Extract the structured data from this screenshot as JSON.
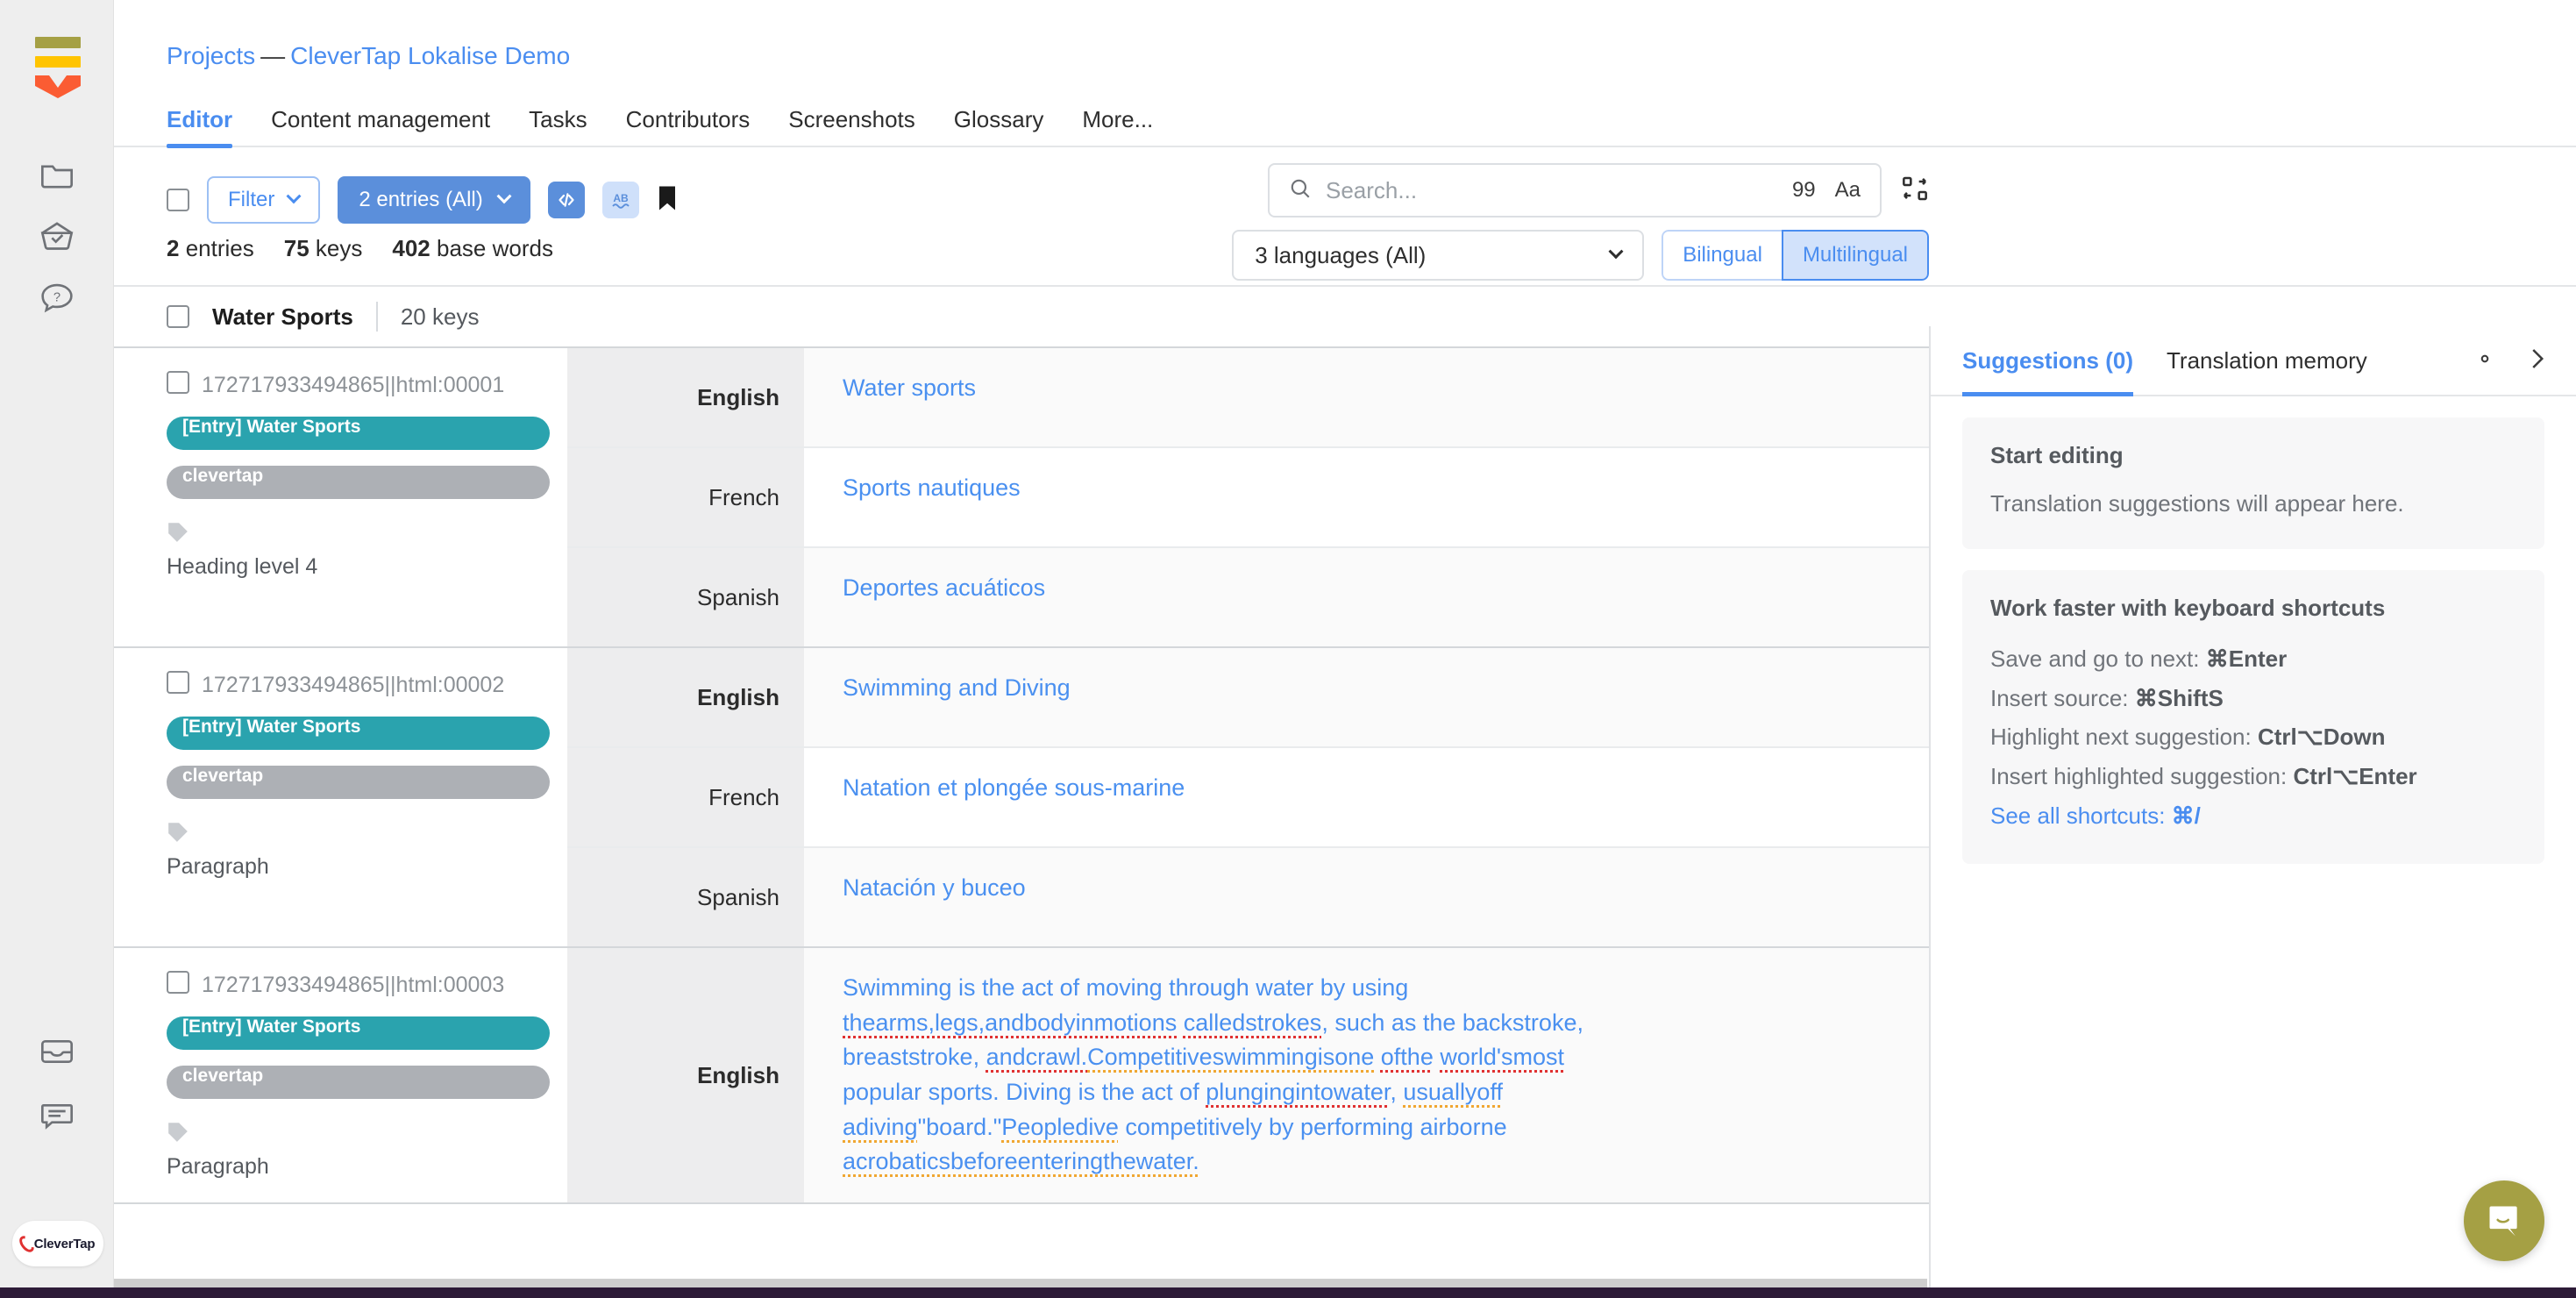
{
  "rail": {
    "logo_name": "lokalise-logo",
    "items": [
      {
        "name": "projects-icon",
        "label": "Projects"
      },
      {
        "name": "tasks-basket-icon",
        "label": "Tasks"
      },
      {
        "name": "help-icon",
        "label": "Help"
      },
      {
        "name": "inbox-icon",
        "label": "Inbox"
      },
      {
        "name": "messages-icon",
        "label": "Messages"
      }
    ],
    "account_badge": "CleverTap"
  },
  "breadcrumb": {
    "projects": "Projects",
    "dash": "—",
    "project": "CleverTap Lokalise Demo"
  },
  "tabs": [
    {
      "label": "Editor",
      "active": true
    },
    {
      "label": "Content management",
      "active": false
    },
    {
      "label": "Tasks",
      "active": false
    },
    {
      "label": "Contributors",
      "active": false
    },
    {
      "label": "Screenshots",
      "active": false
    },
    {
      "label": "Glossary",
      "active": false
    },
    {
      "label": "More...",
      "active": false
    }
  ],
  "toolbar": {
    "filter_label": "Filter",
    "entries_label": "2 entries (All)",
    "code_icon": "code-tags-icon",
    "spellcheck_icon": "ab-spellcheck-icon",
    "bookmark_icon": "bookmark-icon"
  },
  "search": {
    "placeholder": "Search...",
    "value": "",
    "count": "99",
    "case_label": "Aa",
    "grid_icon": "layout-switch-icon"
  },
  "language_bar": {
    "selector_label": "3 languages (All)",
    "bilingual": "Bilingual",
    "multilingual": "Multilingual",
    "active": "Multilingual"
  },
  "counts": {
    "entries_num": "2",
    "entries_word": "entries",
    "keys_num": "75",
    "keys_word": "keys",
    "words_num": "402",
    "words_word": "base words"
  },
  "group": {
    "name": "Water Sports",
    "keys": "20 keys"
  },
  "entries": [
    {
      "key_id": "172717933494865||html:00001",
      "tag_entry": "[Entry] Water Sports",
      "tag_project": "clevertap",
      "type_label": "Heading level 4",
      "rows": [
        {
          "lang": "English",
          "value": "Water sports",
          "warn": null
        },
        {
          "lang": "French",
          "value": "Sports nautiques",
          "warn": null
        },
        {
          "lang": "Spanish",
          "value": "Deportes acuáticos",
          "warn": null
        }
      ]
    },
    {
      "key_id": "172717933494865||html:00002",
      "tag_entry": "[Entry] Water Sports",
      "tag_project": "clevertap",
      "type_label": "Paragraph",
      "rows": [
        {
          "lang": "English",
          "value": "Swimming and Diving",
          "warn": null
        },
        {
          "lang": "French",
          "value": "Natation et plongée sous-marine",
          "warn": null
        },
        {
          "lang": "Spanish",
          "value": "Natación y buceo",
          "warn": null
        }
      ]
    },
    {
      "key_id": "172717933494865||html:00003",
      "tag_entry": "[Entry] Water Sports",
      "tag_project": "clevertap",
      "type_label": "Paragraph",
      "rows": [
        {
          "lang": "English",
          "value": "Swimming is the act of moving through water by using thearms,legs,andbodyinmotions calledstrokes, such as the backstroke, breaststroke, andcrawl.Competitiveswimmingisone ofthe world'smost popular sports. Diving is the act of plungingintowater, usuallyoff adiving\"board.\"Peopledive competitively by performing airborne acrobaticsbeforeenteringthewater.",
          "warn": "1"
        }
      ]
    }
  ],
  "row_action_icons": [
    "comment-icon",
    "proofread-glasses-icon",
    "translate-waves-icon",
    "history-icon"
  ],
  "right_panel": {
    "tabs": [
      {
        "label": "Suggestions (0)",
        "active": true
      },
      {
        "label": "Translation memory",
        "active": false
      }
    ],
    "gear_icon": "gear-icon",
    "collapse_icon": "chevron-right-icon",
    "start_card": {
      "title": "Start editing",
      "body": "Translation suggestions will appear here."
    },
    "shortcuts_card": {
      "title": "Work faster with keyboard shortcuts",
      "lines": [
        {
          "label": "Save and go to next: ",
          "keys": "⌘Enter"
        },
        {
          "label": "Insert source: ",
          "keys": "⌘ShiftS"
        },
        {
          "label": "Highlight next suggestion: ",
          "keys": "Ctrl⌥Down"
        },
        {
          "label": "Insert highlighted suggestion: ",
          "keys": "Ctrl⌥Enter"
        }
      ],
      "see_all_label": "See all shortcuts: ",
      "see_all_keys": "⌘/"
    }
  },
  "support": {
    "bubble_icon": "chat-bubble-icon"
  },
  "colors": {
    "accent_blue": "#4a8df0",
    "primary_button": "#5b8fdb",
    "tag_teal": "#2aa3ae",
    "tag_gray": "#adb0b5",
    "warning_orange": "#f79b73",
    "logo_olive": "#a5a044",
    "logo_yellow": "#ffc400",
    "logo_orange": "#fb5c33"
  }
}
